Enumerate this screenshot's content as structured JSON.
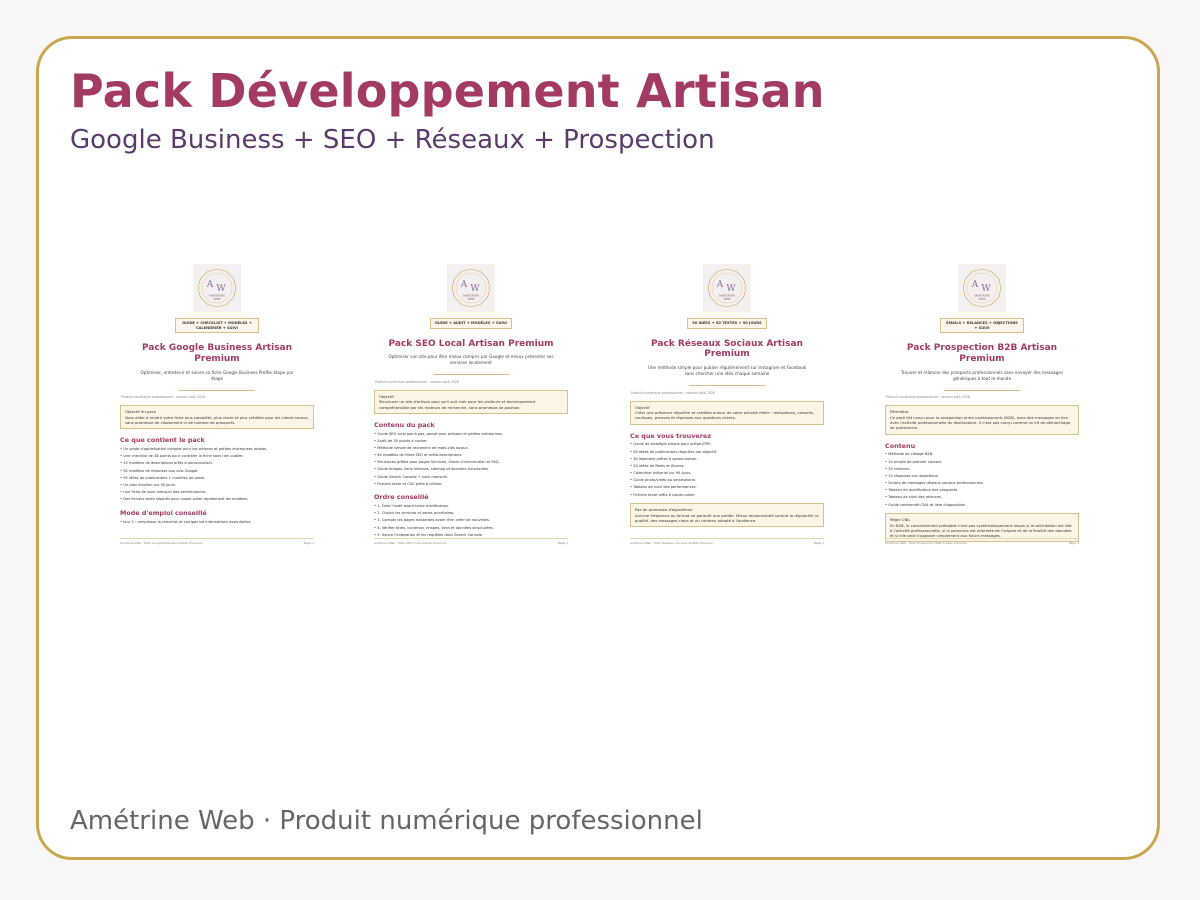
{
  "header": {
    "title": "Pack Développement Artisan",
    "subtitle": "Google Business + SEO + Réseaux + Prospection"
  },
  "footer": {
    "text": "Amétrine Web · Produit numérique professionnel"
  },
  "colors": {
    "accent": "#a23a62",
    "gold": "#c9a64f",
    "subtitle": "#5b3b6b"
  },
  "logo": {
    "monogram_left": "A",
    "monogram_right": "W",
    "line1": "AMÉTRINE",
    "line2": "WEB"
  },
  "docs": [
    {
      "tag": "GUIDE + CHECKLIST + MODÈLES + CALENDRIER + SUIVI",
      "title": "Pack Google Business Artisan Premium",
      "intro": "Optimiser, entretenir et suivre sa fiche Google Business Profile étape par étape",
      "meta": "Produit numérique professionnel · version août 2026",
      "box_title": "Objectif du pack",
      "box_text": "Vous aider à rendre votre fiche plus complète, plus claire et plus crédible pour les clients locaux, sans promesse de classement ni de nombre de prospects.",
      "section1": "Ce que contient le pack",
      "items1": [
        "Un guide d'optimisation complet pour les artisans et petites entreprises locales.",
        "Une checklist de 38 points pour contrôler la fiche sans rien oublier.",
        "10 modèles de descriptions prêts à personnaliser.",
        "30 modèles de réponses aux avis Google.",
        "90 idées de publications + modèles de posts.",
        "Un plan d'action sur 30 jours.",
        "Une fiche de suivi mensuel des performances.",
        "Des fichiers texte séparés pour copier-coller rapidement les modèles."
      ],
      "section2": "Mode d'emploi conseillé",
      "items2": [
        "Jour 1 : remplissez la checklist et corrigez les informations essentielles."
      ],
      "foot_left": "Amétrine Web · Pack Google Business Artisan Premium",
      "foot_right": "Page 1"
    },
    {
      "tag": "GUIDE + AUDIT + MODÈLES + SUIVI",
      "title": "Pack SEO Local Artisan Premium",
      "intro": "Optimiser son site pour être mieux compris par Google et mieux présenter ses services localement",
      "meta": "Produit numérique professionnel · version août 2026",
      "box_title": "Objectif",
      "box_text": "Structurer un site d'artisan pour qu'il soit clair pour les visiteurs et techniquement compréhensible par les moteurs de recherche, sans promesse de position.",
      "section1": "Contenu du pack",
      "items1": [
        "Guide SEO local pas à pas, pensé pour artisans et petites entreprises.",
        "Audit de 50 points à cocher.",
        "Méthode simple de recherche de mots-clés locaux.",
        "40 modèles de titres SEO et méta descriptions.",
        "Structures prêtes pour pages Services, Zones d'intervention et FAQ.",
        "Guide images, liens internes, sitemap et données structurées.",
        "Guide Search Console + suivi mensuel.",
        "Fichiers texte et CSV prêts à utiliser."
      ],
      "section2": "Ordre conseillé",
      "items2": [
        "1. Faire l'audit avant toute modification.",
        "2. Choisir les services et zones prioritaires.",
        "3. Corriger les pages existantes avant d'en créer de nouvelles.",
        "4. Vérifier titres, contenus, images, liens et données structurées.",
        "5. Suivre l'indexation et les requêtes dans Search Console."
      ],
      "foot_left": "Amétrine Web · Pack SEO Local Artisan Premium",
      "foot_right": "Page 1"
    },
    {
      "tag": "90 IDÉES + 30 TEXTES + 90 JOURS",
      "title": "Pack Réseaux Sociaux Artisan Premium",
      "intro": "Une méthode simple pour publier régulièrement sur Instagram et Facebook sans chercher une idée chaque semaine",
      "meta": "Produit numérique professionnel · version août 2026",
      "box_title": "Objectif",
      "box_text": "Créer une présence régulière et crédible autour de votre activité réelle : réalisations, conseils, coulisses, preuves et réponses aux questions clients.",
      "section1": "Ce que vous trouverez",
      "items1": [
        "Guide de stratégie simple pour artisan/TPE.",
        "90 idées de publications réparties par objectif.",
        "30 légendes prêtes à personnaliser.",
        "20 idées de Reels et Stories.",
        "Calendrier éditorial sur 90 jours.",
        "Guide photo/vidéo au smartphone.",
        "Tableau de suivi des performances.",
        "Fichiers texte prêts à copier-coller."
      ],
      "box2_title": "Pas de promesse d'algorithme",
      "box2_text": "Aucune fréquence ou format ne garantit une portée. Mieux recommandé surtout la régularité, la qualité, des messages clairs et du contenu adapté à l'audience.",
      "foot_left": "Amétrine Web · Pack Réseaux Sociaux Artisan Premium",
      "foot_right": "Page 1"
    },
    {
      "tag": "EMAILS + RELANCES + OBJECTIONS + SUIVI",
      "title": "Pack Prospection B2B Artisan Premium",
      "intro": "Trouver et relancer des prospects professionnels sans envoyer des messages génériques à tout le monde",
      "meta": "Produit numérique professionnel · version août 2026",
      "box_title": "Périmètre",
      "box_text": "Ce pack est conçu pour la prospection entre professionnels (B2B), avec des messages en lien avec l'activité professionnelle du destinataire. Il n'est pas conçu comme un kit de démarchage de particuliers.",
      "section1": "Contenu",
      "items1": [
        "Méthode de ciblage B2B.",
        "20 emails de premier contact.",
        "20 relances.",
        "15 réponses aux objections.",
        "Scripts de messages réseaux sociaux professionnels.",
        "Tableau de qualification des prospects.",
        "Tableau de suivi des relances.",
        "Guide conformité CNIL et liste d'opposition."
      ],
      "box2_title": "Règle CNIL",
      "box2_text": "En B2B, le consentement préalable n'est pas systématiquement requis si la sollicitation est liée à l'activité professionnelle, si la personne est informée de l'origine et de la finalité des données et si elle peut s'opposer simplement aux futurs messages.",
      "foot_left": "Amétrine Web · Pack Prospection B2B Artisan Premium",
      "foot_right": "Page 1"
    }
  ]
}
